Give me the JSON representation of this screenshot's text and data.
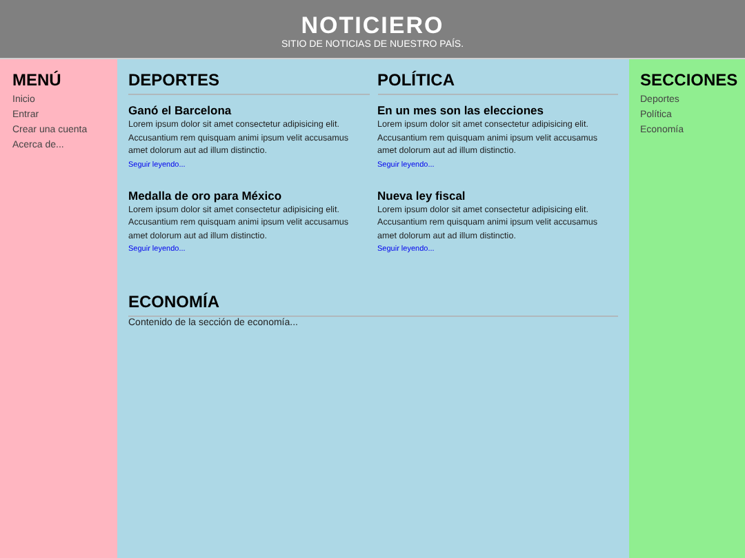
{
  "header": {
    "title": "NOTICIERO",
    "subtitle": "SITIO DE NOTICIAS DE NUESTRO PAÍS."
  },
  "menu": {
    "title": "MENÚ",
    "items": [
      "Inicio",
      "Entrar",
      "Crear una cuenta",
      "Acerca de..."
    ]
  },
  "sections": [
    {
      "title": "DEPORTES",
      "articles": [
        {
          "title": "Ganó el Barcelona",
          "body": "Lorem ipsum dolor sit amet consectetur adipisicing elit. Accusantium rem quisquam animi ipsum velit accusamus amet dolorum aut ad illum distinctio.",
          "link": "Seguir leyendo..."
        },
        {
          "title": "Medalla de oro para México",
          "body": "Lorem ipsum dolor sit amet consectetur adipisicing elit. Accusantium rem quisquam animi ipsum velit accusamus amet dolorum aut ad illum distinctio.",
          "link": "Seguir leyendo..."
        }
      ]
    },
    {
      "title": "POLÍTICA",
      "articles": [
        {
          "title": "En un mes son las elecciones",
          "body": "Lorem ipsum dolor sit amet consectetur adipisicing elit. Accusantium rem quisquam animi ipsum velit accusamus amet dolorum aut ad illum distinctio.",
          "link": "Seguir leyendo..."
        },
        {
          "title": "Nueva ley fiscal",
          "body": "Lorem ipsum dolor sit amet consectetur adipisicing elit. Accusantium rem quisquam animi ipsum velit accusamus amet dolorum aut ad illum distinctio.",
          "link": "Seguir leyendo..."
        }
      ]
    }
  ],
  "economy": {
    "title": "ECONOMÍA",
    "text": "Contenido de la sección de economía..."
  },
  "sidebar": {
    "title": "SECCIONES",
    "items": [
      "Deportes",
      "Política",
      "Economía"
    ]
  }
}
